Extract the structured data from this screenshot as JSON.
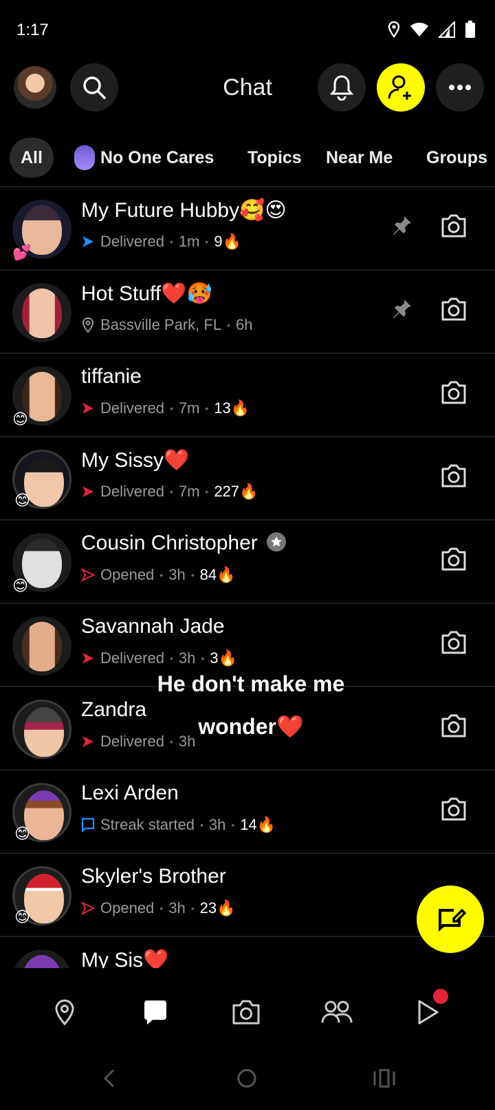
{
  "status": {
    "time": "1:17"
  },
  "header": {
    "title": "Chat"
  },
  "filters": [
    {
      "label": "All"
    },
    {
      "label": "No One Cares"
    },
    {
      "label": "Topics"
    },
    {
      "label": "Near Me"
    },
    {
      "label": "Groups"
    }
  ],
  "chats": [
    {
      "name": "My Future Hubby🥰😍",
      "status_icon": "delivered-arrow-blue",
      "status": "Delivered",
      "time": "1m",
      "streak": "9🔥",
      "pinned": true
    },
    {
      "name": "Hot Stuff❤️🥵",
      "status_icon": "location-pin",
      "status": "Bassville Park, FL",
      "time": "6h",
      "streak": "",
      "pinned": true
    },
    {
      "name": "tiffanie",
      "status_icon": "delivered-arrow-red",
      "status": "Delivered",
      "time": "7m",
      "streak": "13🔥",
      "pinned": false
    },
    {
      "name": "My Sissy❤️",
      "status_icon": "delivered-arrow-red",
      "status": "Delivered",
      "time": "7m",
      "streak": "227🔥",
      "pinned": false
    },
    {
      "name": "Cousin Christopher",
      "status_icon": "opened-arrow-red",
      "status": "Opened",
      "time": "3h",
      "streak": "84🔥",
      "pinned": false
    },
    {
      "name": "Savannah Jade",
      "status_icon": "delivered-arrow-red",
      "status": "Delivered",
      "time": "3h",
      "streak": "3🔥",
      "pinned": false
    },
    {
      "name": "Zandra",
      "status_icon": "delivered-arrow-red",
      "status": "Delivered",
      "time": "3h",
      "streak": "",
      "pinned": false
    },
    {
      "name": "Lexi Arden",
      "status_icon": "chat-bubble-blue",
      "status": "Streak started",
      "time": "3h",
      "streak": "14🔥",
      "pinned": false
    },
    {
      "name": "Skyler's Brother",
      "status_icon": "opened-arrow-red",
      "status": "Opened",
      "time": "3h",
      "streak": "23🔥",
      "pinned": false
    },
    {
      "name": "My Sis❤️",
      "status_icon": "",
      "status": "",
      "time": "",
      "streak": "",
      "pinned": false
    }
  ],
  "overlay": {
    "line1": "He don't make me",
    "line2": "wonder❤️"
  },
  "colors": {
    "snap_yellow": "#fffc00",
    "delivered_red": "#e0243b",
    "delivered_blue": "#1e90ff",
    "background": "#000000"
  }
}
